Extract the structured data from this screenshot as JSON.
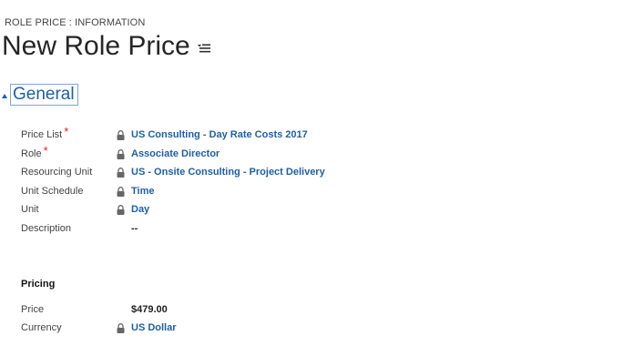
{
  "breadcrumb": "ROLE PRICE : INFORMATION",
  "page_title": "New Role Price",
  "section_title": "General",
  "fields": [
    {
      "label": "Price List",
      "required": "*",
      "value": "US Consulting - Day Rate Costs 2017"
    },
    {
      "label": "Role",
      "required": "*",
      "value": "Associate Director"
    },
    {
      "label": "Resourcing Unit",
      "value": "US - Onsite Consulting - Project Delivery"
    },
    {
      "label": "Unit Schedule",
      "value": "Time"
    },
    {
      "label": "Unit",
      "value": "Day"
    },
    {
      "label": "Description",
      "value": "--"
    }
  ],
  "pricing": {
    "title": "Pricing",
    "price_label": "Price",
    "price_value": "$479.00",
    "currency_label": "Currency",
    "currency_value": "US Dollar"
  },
  "colors": {
    "link": "#1f5fa6",
    "required": "#e0201b"
  },
  "icons": {
    "lock": "lock-icon",
    "menu": "form-menu-icon",
    "collapse": "collapse-triangle-icon"
  }
}
